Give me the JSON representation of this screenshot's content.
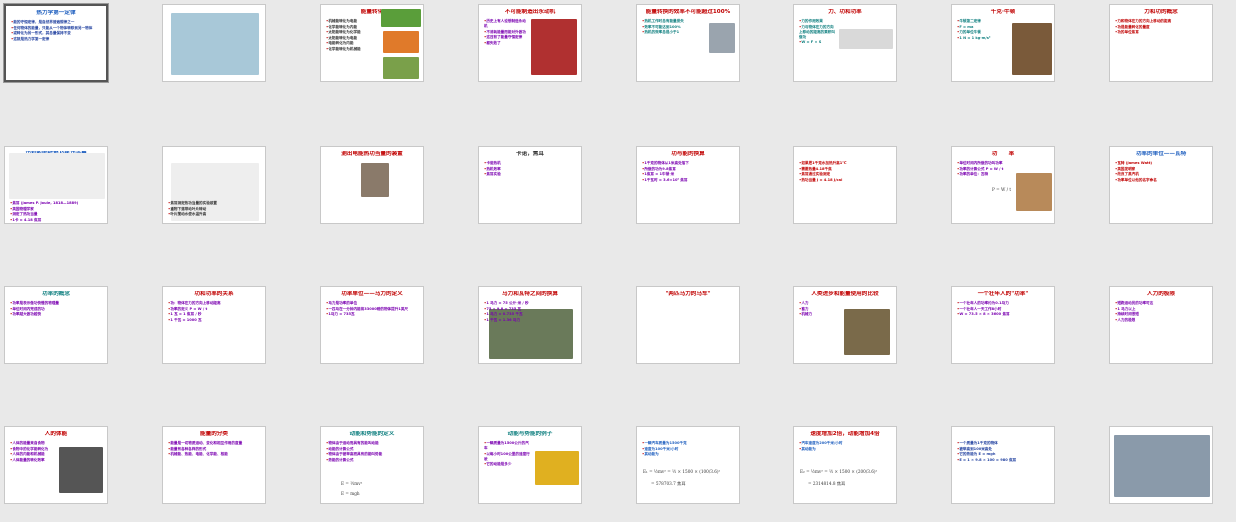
{
  "slides": [
    {
      "title": "热力学第一定律",
      "title_color": "#1f5fbf",
      "lines": [
        "能的守恒定律，是自然界普遍规律之一",
        "任何物体的能量，只能从一个物体转移到另一物体",
        "或转化为另一形式，其总量保持不变",
        "这就是热力学第一定律"
      ],
      "text_color": "#1f3f9f"
    },
    {
      "title": "",
      "lines": [],
      "text_color": "#333333"
    },
    {
      "title": "能量转化",
      "title_color": "#c00000",
      "lines": [
        "机械能转化为电能",
        "化学能转化为内能",
        "太阳能转化为化学能",
        "太阳能转化为电能",
        "电能转化为内能",
        "化学能转化为机械能"
      ],
      "text_color": "#333333"
    },
    {
      "title": "不可能制造出永动机",
      "title_color": "#c00000",
      "lines": [
        "历史上有人设想制造永动机",
        "不消耗能量而能对外做功",
        "这违背了能量守恒定律",
        "都失败了"
      ],
      "text_color": "#7a00b0"
    },
    {
      "title": "能量转换的效率不可能超过100%",
      "title_color": "#c00000",
      "lines": [
        "热机工作时总有能量损失",
        "效率不可能达到100%",
        "热机的效率总是小于1"
      ],
      "text_color": "#118080"
    },
    {
      "title": "力、功和功率",
      "title_color": "#c00000",
      "lines": [
        "力的作用效果",
        "力与物体在力的方向上移动的距离的乘积叫做功",
        "W = F × S"
      ],
      "text_color": "#118080"
    },
    {
      "title": "千克·牛顿",
      "title_color": "#c00000",
      "lines": [
        "牛顿第二定律",
        "F = ma",
        "力的单位牛顿",
        "1 N = 1 kg·m/s²"
      ],
      "text_color": "#118080"
    },
    {
      "title": "力和功的概念",
      "title_color": "#c00000",
      "lines": [
        "力和物体在力的方向上移动的距离",
        "功是能量转化的量度",
        "功的单位焦耳"
      ],
      "text_color": "#c00000"
    },
    {
      "title": "功和能的转换及热功当量",
      "title_color": "#1f5fbf",
      "lines": [
        "焦耳 (James P. Joule, 1818—1889)",
        "英国物理学家",
        "测定了热功当量",
        "1卡 = 4.18 焦耳"
      ],
      "text_color": "#7a00b0"
    },
    {
      "title": "",
      "lines": [
        "焦耳测定热功当量的实验装置",
        "重物下落带动叶片转动",
        "叶片搅动水使水温升高"
      ],
      "text_color": "#333333"
    },
    {
      "title": "测出电能热功当量的装置",
      "title_color": "#c00000",
      "lines": [],
      "text_color": "#333333"
    },
    {
      "title": "卡诺，焦耳",
      "title_color": "#333333",
      "lines": [
        "卡诺热机",
        "热机效率",
        "焦耳实验"
      ],
      "text_color": "#7a00b0"
    },
    {
      "title": "功与能的换算",
      "title_color": "#c00000",
      "lines": [
        "1千克的物体从1米高处落下",
        "所做的功为9.8焦耳",
        "1焦耳 = 1牛顿·米",
        "1千瓦时 = 3.6×10⁶ 焦耳"
      ],
      "text_color": "#7a00b0"
    },
    {
      "title": "",
      "lines": [
        "如果把1千克水加热升高1℃",
        "需要热量4.18千焦",
        "焦耳通过实验测定",
        "热功当量 J = 4.18 J/cal"
      ],
      "text_color": "#c00000"
    },
    {
      "title": "功　　率",
      "title_color": "#c00000",
      "lines": [
        "单位时间内所做的功叫功率",
        "功率的计算公式 P = W / t",
        "功率的单位：瓦特"
      ],
      "text_color": "#7a00b0"
    },
    {
      "title": "功率的单位——瓦特",
      "title_color": "#1f5fbf",
      "lines": [
        "瓦特 (James Watt)",
        "英国发明家",
        "改良了蒸汽机",
        "功率单位以他的名字命名"
      ],
      "text_color": "#c00000"
    },
    {
      "title": "功率的概念",
      "title_color": "#118080",
      "lines": [
        "功率是表示做功快慢的物理量",
        "单位时间内完成的功",
        "功率越大做功越快"
      ],
      "text_color": "#7a00b0"
    },
    {
      "title": "功和功率的关系",
      "title_color": "#c00000",
      "lines": [
        "功：物体在力的方向上移动距离",
        "功率的定义 P = W / t",
        "1 瓦 = 1 焦耳 / 秒",
        "1 千瓦 = 1000 瓦"
      ],
      "text_color": "#7a00b0"
    },
    {
      "title": "功率单位——马力的定义",
      "title_color": "#c00000",
      "lines": [
        "马力是功率的单位",
        "一匹马在一分钟内能将33000磅的物体提升1英尺",
        "1马力 = 735瓦"
      ],
      "text_color": "#7a00b0"
    },
    {
      "title": "马力和瓦特之间的换算",
      "title_color": "#c00000",
      "lines": [
        "1 马力 = 75 公斤·米 / 秒",
        "75 × 9.8 = 735 瓦",
        "1 马力 = 0.735 千瓦",
        "1 千瓦 = 1.36 马力"
      ],
      "text_color": "#7a00b0"
    },
    {
      "title": "\"两匹马力的马车\"",
      "title_color": "#c00000",
      "lines": [],
      "text_color": "#333333"
    },
    {
      "title": "人类进步和能量使用的比较",
      "title_color": "#c00000",
      "lines": [
        "人力",
        "畜力",
        "机械力"
      ],
      "text_color": "#7a00b0"
    },
    {
      "title": "一个壮年人的\"功率\"",
      "title_color": "#c00000",
      "lines": [
        "一个壮年人的功率约为0.1马力",
        "一个壮年人一天工作8小时",
        "W = 73.5 × 8 × 3600 焦耳"
      ],
      "text_color": "#7a00b0"
    },
    {
      "title": "人力的极限",
      "title_color": "#c00000",
      "lines": [
        "短跑运动员的功率可达",
        "1 马力以上",
        "持续时间很短",
        "人力的极限"
      ],
      "text_color": "#7a00b0"
    },
    {
      "title": "人的体能",
      "title_color": "#c00000",
      "lines": [
        "人体的能量来自食物",
        "食物中的化学能转化为",
        "人体的内能和机械能",
        "人体能量的转化效率"
      ],
      "text_color": "#7a00b0"
    },
    {
      "title": "能量的分类",
      "title_color": "#c00000",
      "lines": [
        "能量是一切物质运动、变化和相互作用的度量",
        "能量有各种各样的形式",
        "机械能、热能、电能、化学能、核能"
      ],
      "text_color": "#7a00b0"
    },
    {
      "title": "动能和势能的定义",
      "title_color": "#118080",
      "lines": [
        "物体由于运动而具有的能叫动能",
        "动能的计算公式",
        "物体由于被举高而具有的能叫势能",
        "势能的计算公式"
      ],
      "text_color": "#7a00b0"
    },
    {
      "title": "动能与势能的例子",
      "title_color": "#118080",
      "lines": [
        "一辆质量为1500公斤的汽车",
        "以每小时100公里的速度行驶",
        "它的动能是多少"
      ],
      "text_color": "#7a00b0"
    },
    {
      "title": "",
      "lines": [
        "一辆汽车质量为1500千克",
        "速度为100千米/小时",
        "其动能为"
      ],
      "text_color": "#1f5fbf"
    },
    {
      "title": "速度增加2倍，动能增加4倍",
      "title_color": "#c00000",
      "lines": [
        "汽车速度为200千米/小时",
        "其动能为"
      ],
      "text_color": "#1f5fbf"
    },
    {
      "title": "",
      "lines": [
        "一个质量为1千克的物体",
        "被举高到100米高处",
        "它的势能为 E = mgh",
        "E = 1 × 9.8 × 100 = 980 焦耳"
      ],
      "text_color": "#1f3f9f"
    },
    {
      "title": "",
      "lines": [],
      "text_color": "#333333"
    }
  ],
  "formulas": {
    "kinetic_1": "E₁ = ½mv² = ½ × 1500 × (100/3.6)²",
    "kinetic_1b": "= 578703.7 焦耳",
    "kinetic_2": "E₂ = ½mv² = ½ × 1500 × (200/3.6)²",
    "kinetic_2b": "= 2314814.8 焦耳",
    "kinetic_def": "E = ½mv²",
    "potential_def": "E = mgh",
    "power_def": "P = W / t"
  }
}
